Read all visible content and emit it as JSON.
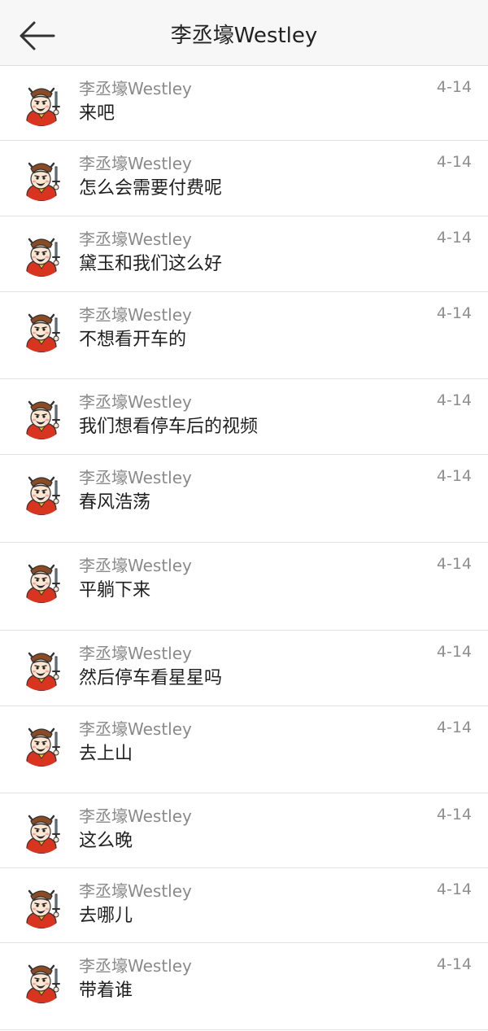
{
  "header": {
    "title": "李丞壕Westley",
    "back_icon": "back-arrow-icon"
  },
  "comments": [
    {
      "name": "李丞壕Westley",
      "text": "来吧",
      "date": "4-14"
    },
    {
      "name": "李丞壕Westley",
      "text": "怎么会需要付费呢",
      "date": "4-14"
    },
    {
      "name": "李丞壕Westley",
      "text": "黛玉和我们这么好",
      "date": "4-14"
    },
    {
      "name": "李丞壕Westley",
      "text": "不想看开车的",
      "date": "4-14"
    },
    {
      "name": "李丞壕Westley",
      "text": "我们想看停车后的视频",
      "date": "4-14"
    },
    {
      "name": "李丞壕Westley",
      "text": "春风浩荡",
      "date": "4-14"
    },
    {
      "name": "李丞壕Westley",
      "text": "平躺下来",
      "date": "4-14"
    },
    {
      "name": "李丞壕Westley",
      "text": "然后停车看星星吗",
      "date": "4-14"
    },
    {
      "name": "李丞壕Westley",
      "text": "去上山",
      "date": "4-14"
    },
    {
      "name": "李丞壕Westley",
      "text": "这么晚",
      "date": "4-14"
    },
    {
      "name": "李丞壕Westley",
      "text": "去哪儿",
      "date": "4-14"
    },
    {
      "name": "李丞壕Westley",
      "text": "带着谁",
      "date": "4-14"
    }
  ]
}
